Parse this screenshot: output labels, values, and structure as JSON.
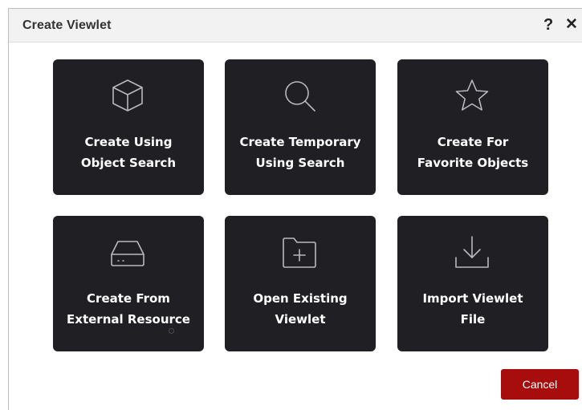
{
  "dialog": {
    "title": "Create Viewlet",
    "help_icon": "?",
    "close_icon": "✕"
  },
  "tiles": [
    {
      "label": "Create Using\nObject Search",
      "icon": "cube-icon"
    },
    {
      "label": "Create Temporary\nUsing Search",
      "icon": "search-icon"
    },
    {
      "label": "Create For\nFavorite Objects",
      "icon": "star-icon"
    },
    {
      "label": "Create From\nExternal Resource",
      "icon": "drive-icon"
    },
    {
      "label": "Open Existing\nViewlet",
      "icon": "folder-plus-icon"
    },
    {
      "label": "Import Viewlet\nFile",
      "icon": "download-icon"
    }
  ],
  "footer": {
    "cancel_label": "Cancel"
  },
  "colors": {
    "tile_background": "#1f1f24",
    "cancel_button": "#a80d0d",
    "header_background": "#f2f2f2"
  }
}
